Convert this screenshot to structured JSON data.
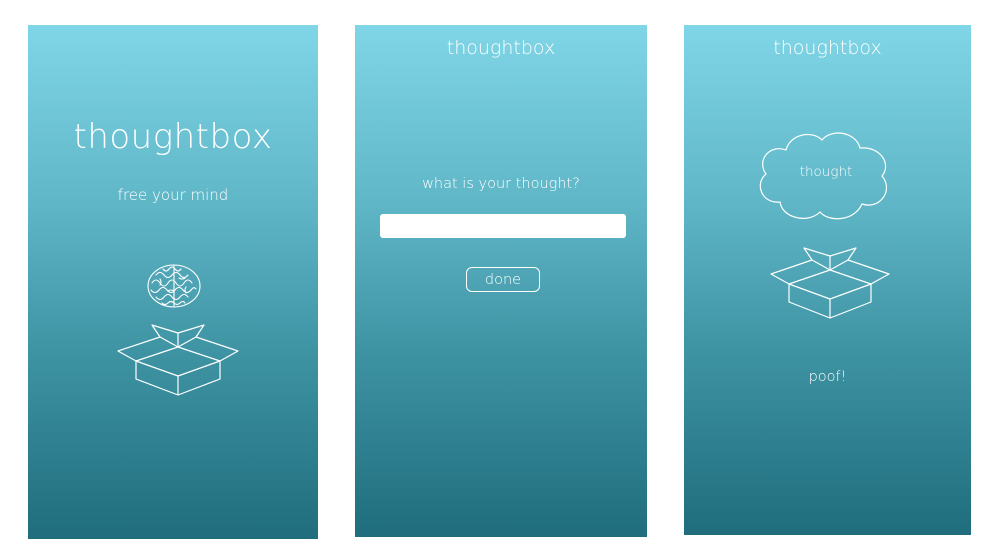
{
  "screens": [
    {
      "title": "thoughtbox",
      "tagline": "free your mind",
      "icons": [
        "brain-icon",
        "open-box-icon"
      ]
    },
    {
      "title": "thoughtbox",
      "prompt": "what is your thought?",
      "input_value": "",
      "input_placeholder": "",
      "done_label": "done"
    },
    {
      "title": "thoughtbox",
      "cloud_label": "thought",
      "status": "poof!",
      "icons": [
        "cloud-icon",
        "open-box-icon"
      ]
    }
  ],
  "colors": {
    "gradient_top": "#80d6e6",
    "gradient_bottom": "#1f6d7d",
    "foreground": "#ffffff"
  }
}
